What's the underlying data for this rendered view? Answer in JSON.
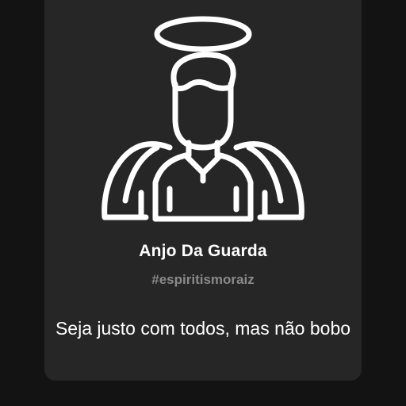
{
  "card": {
    "icon": "angel-halo-icon",
    "title": "Anjo Da Guarda",
    "tag": "#espiritismoraiz",
    "quote": "Seja justo com todos, mas não bobo"
  },
  "colors": {
    "background": "#131313",
    "card": "#262626",
    "title": "#ffffff",
    "tag": "#8a8a8a",
    "icon_stroke": "#ffffff"
  }
}
